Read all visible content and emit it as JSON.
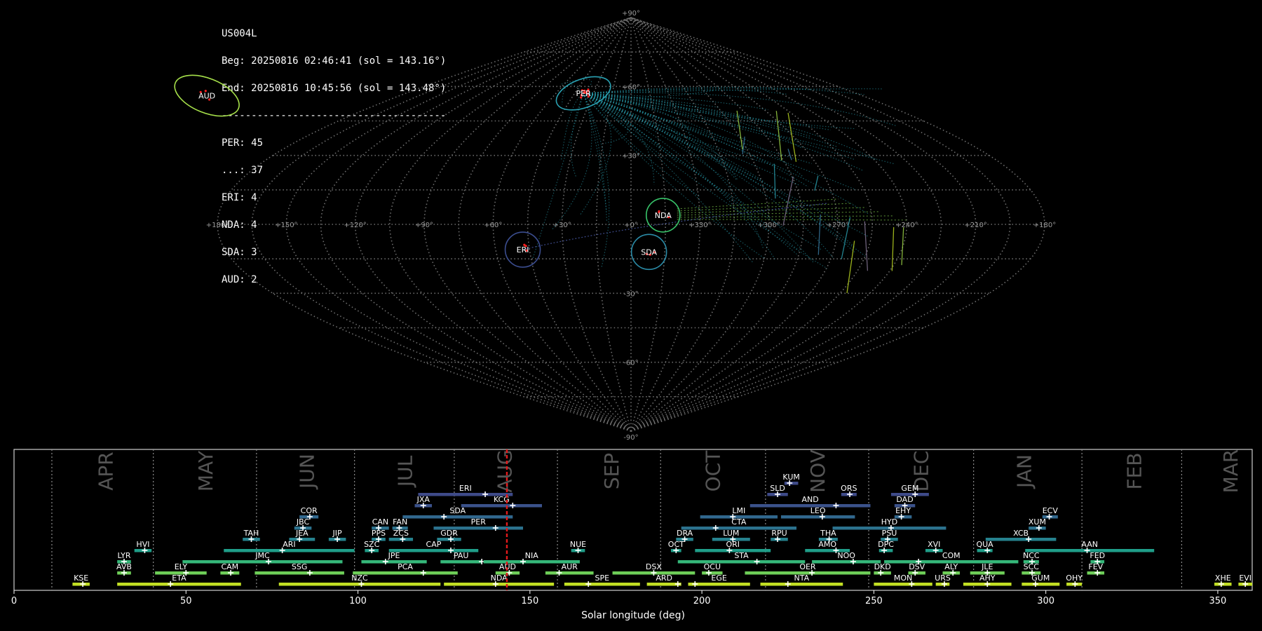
{
  "info": {
    "station": "US004L",
    "begin": "Beg: 20250816 02:46:41 (sol = 143.16°)",
    "end": "End: 20250816 10:45:56 (sol = 143.48°)",
    "separator": "--------------------------------------",
    "counts": [
      "PER: 45",
      "...: 37",
      "ERI: 4",
      "NDA: 4",
      "SDA: 3",
      "AUD: 2"
    ]
  },
  "skymap": {
    "lon_ticks": [
      180,
      150,
      120,
      90,
      60,
      30,
      0,
      330,
      300,
      270,
      240,
      210,
      180
    ],
    "lon_labels": [
      "+180°",
      "+150°",
      "+120°",
      "+90°",
      "+60°",
      "+30°",
      "+0°",
      "+330°",
      "+300°",
      "+270°",
      "+240°",
      "+210°",
      "+180°"
    ],
    "lat_ticks": [
      90,
      60,
      30,
      -30,
      -60,
      -90
    ],
    "lat_labels": [
      "+90°",
      "+60°",
      "+30°",
      "-30°",
      "-60°",
      "-90°"
    ],
    "radiants": [
      {
        "name": "PER",
        "lon": 38,
        "lat": 57,
        "r": 30,
        "color": "#2aa2b3"
      },
      {
        "name": "AUD",
        "lon": 330,
        "lat": 56,
        "r": 36,
        "color": "#a6e04a"
      },
      {
        "name": "NDA",
        "lon": -14,
        "lat": 4,
        "r": 24,
        "color": "#38c46a"
      },
      {
        "name": "ERI",
        "lon": 48,
        "lat": -11,
        "r": 25,
        "color": "#3b4d8f"
      },
      {
        "name": "SDA",
        "lon": -8,
        "lat": -12,
        "r": 25,
        "color": "#2b8ca8"
      }
    ]
  },
  "chart_data": {
    "type": "timeline",
    "xlabel": "Solar longitude (deg)",
    "xlim": [
      0,
      360
    ],
    "xticks": [
      0,
      50,
      100,
      150,
      200,
      250,
      300,
      350
    ],
    "current_sol": 143.3,
    "months": [
      {
        "name": "APR",
        "center": 25
      },
      {
        "name": "MAY",
        "center": 54
      },
      {
        "name": "JUN",
        "center": 83.5
      },
      {
        "name": "JUL",
        "center": 112
      },
      {
        "name": "AUG",
        "center": 141
      },
      {
        "name": "SEP",
        "center": 172
      },
      {
        "name": "OCT",
        "center": 201.5
      },
      {
        "name": "NOV",
        "center": 232
      },
      {
        "name": "DEC",
        "center": 262
      },
      {
        "name": "JAN",
        "center": 292
      },
      {
        "name": "FEB",
        "center": 324
      },
      {
        "name": "MAR",
        "center": 352
      }
    ],
    "month_boundaries": [
      11,
      40.5,
      70.5,
      99,
      128,
      158,
      188,
      218.5,
      248.5,
      279,
      310.5,
      339.5
    ],
    "showers": [
      {
        "code": "KUM",
        "start": 224,
        "end": 228,
        "peak": 225.5,
        "row": 10,
        "color": "#3e4a89"
      },
      {
        "code": "ERI",
        "start": 117.5,
        "end": 145,
        "peak": 137,
        "row": 9,
        "color": "#3e4a89"
      },
      {
        "code": "SLD",
        "start": 219,
        "end": 225,
        "peak": 222,
        "row": 9,
        "color": "#3e4a89"
      },
      {
        "code": "ORS",
        "start": 240.5,
        "end": 245,
        "peak": 243,
        "row": 9,
        "color": "#3e4a89"
      },
      {
        "code": "GEM",
        "start": 255,
        "end": 266,
        "peak": 262,
        "row": 9,
        "color": "#3e4a89"
      },
      {
        "code": "JXA",
        "start": 116.5,
        "end": 121.5,
        "peak": 119,
        "row": 8,
        "color": "#3b528b"
      },
      {
        "code": "KCG",
        "start": 130,
        "end": 153.5,
        "peak": 145,
        "row": 8,
        "color": "#3b528b"
      },
      {
        "code": "AND",
        "start": 214,
        "end": 249,
        "peak": 239,
        "row": 8,
        "color": "#3b528b"
      },
      {
        "code": "DAD",
        "start": 256,
        "end": 262,
        "peak": 259,
        "row": 8,
        "color": "#3b528b"
      },
      {
        "code": "COR",
        "start": 83,
        "end": 88.5,
        "peak": 86,
        "row": 7,
        "color": "#31688e"
      },
      {
        "code": "SDA",
        "start": 113,
        "end": 145,
        "peak": 125,
        "row": 7,
        "color": "#31688e"
      },
      {
        "code": "LMI",
        "start": 199.5,
        "end": 222,
        "peak": 209,
        "row": 7,
        "color": "#31688e"
      },
      {
        "code": "LEO",
        "start": 223,
        "end": 244.5,
        "peak": 235,
        "row": 7,
        "color": "#31688e"
      },
      {
        "code": "EHY",
        "start": 256,
        "end": 261,
        "peak": 258,
        "row": 7,
        "color": "#31688e"
      },
      {
        "code": "ECV",
        "start": 299,
        "end": 303.5,
        "peak": 301,
        "row": 7,
        "color": "#31688e"
      },
      {
        "code": "JBC",
        "start": 81.5,
        "end": 86.5,
        "peak": 84,
        "row": 6,
        "color": "#2c728e"
      },
      {
        "code": "CAN",
        "start": 104,
        "end": 109,
        "peak": 106,
        "row": 6,
        "color": "#2c728e"
      },
      {
        "code": "FAN",
        "start": 110,
        "end": 114.5,
        "peak": 112,
        "row": 6,
        "color": "#2c728e"
      },
      {
        "code": "PER",
        "start": 122,
        "end": 148,
        "peak": 140,
        "row": 6,
        "color": "#2c728e"
      },
      {
        "code": "CTA",
        "start": 194,
        "end": 227.5,
        "peak": 204,
        "row": 6,
        "color": "#2c728e"
      },
      {
        "code": "HYD",
        "start": 238,
        "end": 271,
        "peak": 255,
        "row": 6,
        "color": "#2c728e"
      },
      {
        "code": "XUM",
        "start": 295,
        "end": 300,
        "peak": 298,
        "row": 6,
        "color": "#2c728e"
      },
      {
        "code": "TAH",
        "start": 66.5,
        "end": 71.5,
        "peak": 69,
        "row": 5,
        "color": "#26828e"
      },
      {
        "code": "JEA",
        "start": 80,
        "end": 87.5,
        "peak": 83,
        "row": 5,
        "color": "#26828e"
      },
      {
        "code": "JIP",
        "start": 91.5,
        "end": 96.5,
        "peak": 94,
        "row": 5,
        "color": "#26828e"
      },
      {
        "code": "PPS",
        "start": 104,
        "end": 108,
        "peak": 106,
        "row": 5,
        "color": "#26828e"
      },
      {
        "code": "ZCS",
        "start": 109,
        "end": 116,
        "peak": 113,
        "row": 5,
        "color": "#26828e"
      },
      {
        "code": "GDR",
        "start": 123,
        "end": 130,
        "peak": 127,
        "row": 5,
        "color": "#26828e"
      },
      {
        "code": "DRA",
        "start": 192.5,
        "end": 197.5,
        "peak": 195,
        "row": 5,
        "color": "#26828e"
      },
      {
        "code": "LUM",
        "start": 203,
        "end": 214,
        "peak": 209,
        "row": 5,
        "color": "#26828e"
      },
      {
        "code": "RPU",
        "start": 220,
        "end": 225,
        "peak": 222,
        "row": 5,
        "color": "#26828e"
      },
      {
        "code": "THA",
        "start": 234,
        "end": 239.5,
        "peak": 237,
        "row": 5,
        "color": "#26828e"
      },
      {
        "code": "PSU",
        "start": 252,
        "end": 257,
        "peak": 254,
        "row": 5,
        "color": "#26828e"
      },
      {
        "code": "XCB",
        "start": 282.5,
        "end": 303,
        "peak": 295,
        "row": 5,
        "color": "#26828e"
      },
      {
        "code": "HVI",
        "start": 35,
        "end": 40,
        "peak": 38,
        "row": 4,
        "color": "#1f9e89"
      },
      {
        "code": "ARI",
        "start": 61,
        "end": 99,
        "peak": 78,
        "row": 4,
        "color": "#1f9e89"
      },
      {
        "code": "SZC",
        "start": 102,
        "end": 106,
        "peak": 104,
        "row": 4,
        "color": "#1f9e89"
      },
      {
        "code": "CAP",
        "start": 109,
        "end": 135,
        "peak": 127,
        "row": 4,
        "color": "#1f9e89"
      },
      {
        "code": "NUE",
        "start": 162,
        "end": 166,
        "peak": 164,
        "row": 4,
        "color": "#1f9e89"
      },
      {
        "code": "OCT",
        "start": 191,
        "end": 194,
        "peak": 192.5,
        "row": 4,
        "color": "#1f9e89"
      },
      {
        "code": "ORI",
        "start": 198,
        "end": 220,
        "peak": 208,
        "row": 4,
        "color": "#1f9e89"
      },
      {
        "code": "AMO",
        "start": 230,
        "end": 243,
        "peak": 239,
        "row": 4,
        "color": "#1f9e89"
      },
      {
        "code": "DPC",
        "start": 251.5,
        "end": 255.5,
        "peak": 253,
        "row": 4,
        "color": "#1f9e89"
      },
      {
        "code": "XVI",
        "start": 265,
        "end": 270,
        "peak": 268,
        "row": 4,
        "color": "#1f9e89"
      },
      {
        "code": "QUA",
        "start": 280,
        "end": 284.5,
        "peak": 283,
        "row": 4,
        "color": "#1f9e89"
      },
      {
        "code": "AAN",
        "start": 294,
        "end": 331.5,
        "peak": 312,
        "row": 4,
        "color": "#1f9e89"
      },
      {
        "code": "LYR",
        "start": 30,
        "end": 34,
        "peak": 32,
        "row": 3,
        "color": "#35b779"
      },
      {
        "code": "JMC",
        "start": 49,
        "end": 95.5,
        "peak": 74,
        "row": 3,
        "color": "#35b779"
      },
      {
        "code": "JPE",
        "start": 101,
        "end": 120,
        "peak": 108,
        "row": 3,
        "color": "#35b779"
      },
      {
        "code": "PAU",
        "start": 124,
        "end": 136,
        "peak": 136,
        "row": 3,
        "color": "#35b779"
      },
      {
        "code": "NIA",
        "start": 136.5,
        "end": 164.5,
        "peak": 148,
        "row": 3,
        "color": "#35b779"
      },
      {
        "code": "STA",
        "start": 193,
        "end": 230,
        "peak": 216,
        "row": 3,
        "color": "#35b779"
      },
      {
        "code": "NOO",
        "start": 232,
        "end": 252,
        "peak": 244,
        "row": 3,
        "color": "#35b779"
      },
      {
        "code": "COM",
        "start": 253,
        "end": 292,
        "peak": 263,
        "row": 3,
        "color": "#35b779"
      },
      {
        "code": "NCC",
        "start": 293.5,
        "end": 298,
        "peak": 296,
        "row": 3,
        "color": "#35b779"
      },
      {
        "code": "FED",
        "start": 313,
        "end": 317,
        "peak": 315,
        "row": 3,
        "color": "#35b779"
      },
      {
        "code": "AVB",
        "start": 30,
        "end": 34,
        "peak": 32,
        "row": 2,
        "color": "#6ece58"
      },
      {
        "code": "ELY",
        "start": 41,
        "end": 56,
        "peak": 50,
        "row": 2,
        "color": "#6ece58"
      },
      {
        "code": "CAM",
        "start": 60,
        "end": 65.5,
        "peak": 63,
        "row": 2,
        "color": "#6ece58"
      },
      {
        "code": "SSG",
        "start": 70,
        "end": 96,
        "peak": 86,
        "row": 2,
        "color": "#6ece58"
      },
      {
        "code": "PCA",
        "start": 98.5,
        "end": 129,
        "peak": 119,
        "row": 2,
        "color": "#6ece58"
      },
      {
        "code": "AUD",
        "start": 140,
        "end": 147,
        "peak": 144,
        "row": 2,
        "color": "#6ece58"
      },
      {
        "code": "AUR",
        "start": 154.5,
        "end": 168.5,
        "peak": 158.5,
        "row": 2,
        "color": "#6ece58"
      },
      {
        "code": "DSX",
        "start": 174,
        "end": 198,
        "peak": 186,
        "row": 2,
        "color": "#6ece58"
      },
      {
        "code": "OCU",
        "start": 200,
        "end": 206,
        "peak": 202,
        "row": 2,
        "color": "#6ece58"
      },
      {
        "code": "OER",
        "start": 212.5,
        "end": 249,
        "peak": 232,
        "row": 2,
        "color": "#6ece58"
      },
      {
        "code": "DKD",
        "start": 250,
        "end": 255,
        "peak": 252,
        "row": 2,
        "color": "#6ece58"
      },
      {
        "code": "DSV",
        "start": 260,
        "end": 265,
        "peak": 262,
        "row": 2,
        "color": "#6ece58"
      },
      {
        "code": "ALY",
        "start": 270,
        "end": 275,
        "peak": 273,
        "row": 2,
        "color": "#6ece58"
      },
      {
        "code": "JLE",
        "start": 278,
        "end": 288,
        "peak": 283,
        "row": 2,
        "color": "#6ece58"
      },
      {
        "code": "SCC",
        "start": 293,
        "end": 298.5,
        "peak": 296,
        "row": 2,
        "color": "#6ece58"
      },
      {
        "code": "FEV",
        "start": 312,
        "end": 317,
        "peak": 315,
        "row": 2,
        "color": "#6ece58"
      },
      {
        "code": "KSE",
        "start": 17,
        "end": 22,
        "peak": 20,
        "row": 1,
        "color": "#c2df23"
      },
      {
        "code": "ETA",
        "start": 30,
        "end": 66,
        "peak": 45.5,
        "row": 1,
        "color": "#c2df23"
      },
      {
        "code": "NZC",
        "start": 77,
        "end": 124,
        "peak": 101,
        "row": 1,
        "color": "#c2df23"
      },
      {
        "code": "NDA",
        "start": 125,
        "end": 157,
        "peak": 140,
        "row": 1,
        "color": "#c2df23"
      },
      {
        "code": "SPE",
        "start": 160,
        "end": 182,
        "peak": 167,
        "row": 1,
        "color": "#c2df23"
      },
      {
        "code": "ARD",
        "start": 184,
        "end": 194,
        "peak": 193,
        "row": 1,
        "color": "#c2df23"
      },
      {
        "code": "EGE",
        "start": 196,
        "end": 214,
        "peak": 198,
        "row": 1,
        "color": "#c2df23"
      },
      {
        "code": "NTA",
        "start": 217,
        "end": 241,
        "peak": 225,
        "row": 1,
        "color": "#c2df23"
      },
      {
        "code": "MON",
        "start": 250,
        "end": 267,
        "peak": 261,
        "row": 1,
        "color": "#c2df23"
      },
      {
        "code": "URS",
        "start": 268,
        "end": 272,
        "peak": 270.5,
        "row": 1,
        "color": "#c2df23"
      },
      {
        "code": "AHY",
        "start": 276,
        "end": 290,
        "peak": 283,
        "row": 1,
        "color": "#c2df23"
      },
      {
        "code": "GUM",
        "start": 293,
        "end": 304,
        "peak": 297,
        "row": 1,
        "color": "#c2df23"
      },
      {
        "code": "OHY",
        "start": 306,
        "end": 310.5,
        "peak": 308.5,
        "row": 1,
        "color": "#c2df23"
      },
      {
        "code": "XHE",
        "start": 349,
        "end": 354,
        "peak": 351,
        "row": 1,
        "color": "#c2df23"
      },
      {
        "code": "EVI",
        "start": 356,
        "end": 361,
        "peak": 358,
        "row": 1,
        "color": "#c2df23"
      }
    ]
  },
  "colors": {
    "grid": "#7a7a7a",
    "current_sol_line": "#e31a1c",
    "radiant_point": "#ff2020",
    "frame": "#cfcfcf"
  }
}
